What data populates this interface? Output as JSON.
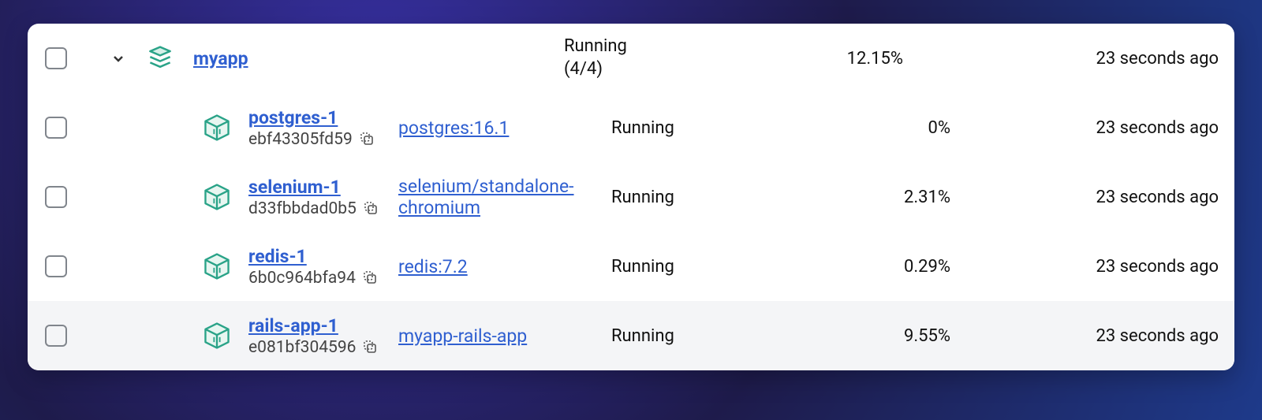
{
  "parent": {
    "name": "myapp",
    "status_line1": "Running",
    "status_line2": "(4/4)",
    "cpu": "12.15%",
    "time": "23 seconds ago"
  },
  "containers": [
    {
      "name": "postgres-1",
      "id": "ebf43305fd59",
      "image": "postgres:16.1",
      "status": "Running",
      "cpu": "0%",
      "time": "23 seconds ago",
      "highlight": false
    },
    {
      "name": "selenium-1",
      "id": "d33fbbdad0b5",
      "image": "selenium/standalone-chromium",
      "status": "Running",
      "cpu": "2.31%",
      "time": "23 seconds ago",
      "highlight": false
    },
    {
      "name": "redis-1",
      "id": "6b0c964bfa94",
      "image": "redis:7.2",
      "status": "Running",
      "cpu": "0.29%",
      "time": "23 seconds ago",
      "highlight": false
    },
    {
      "name": "rails-app-1",
      "id": "e081bf304596",
      "image": "myapp-rails-app",
      "status": "Running",
      "cpu": "9.55%",
      "time": "23 seconds ago",
      "highlight": true
    }
  ],
  "colors": {
    "link": "#2f5fd0",
    "icon_teal": "#2aa388"
  }
}
